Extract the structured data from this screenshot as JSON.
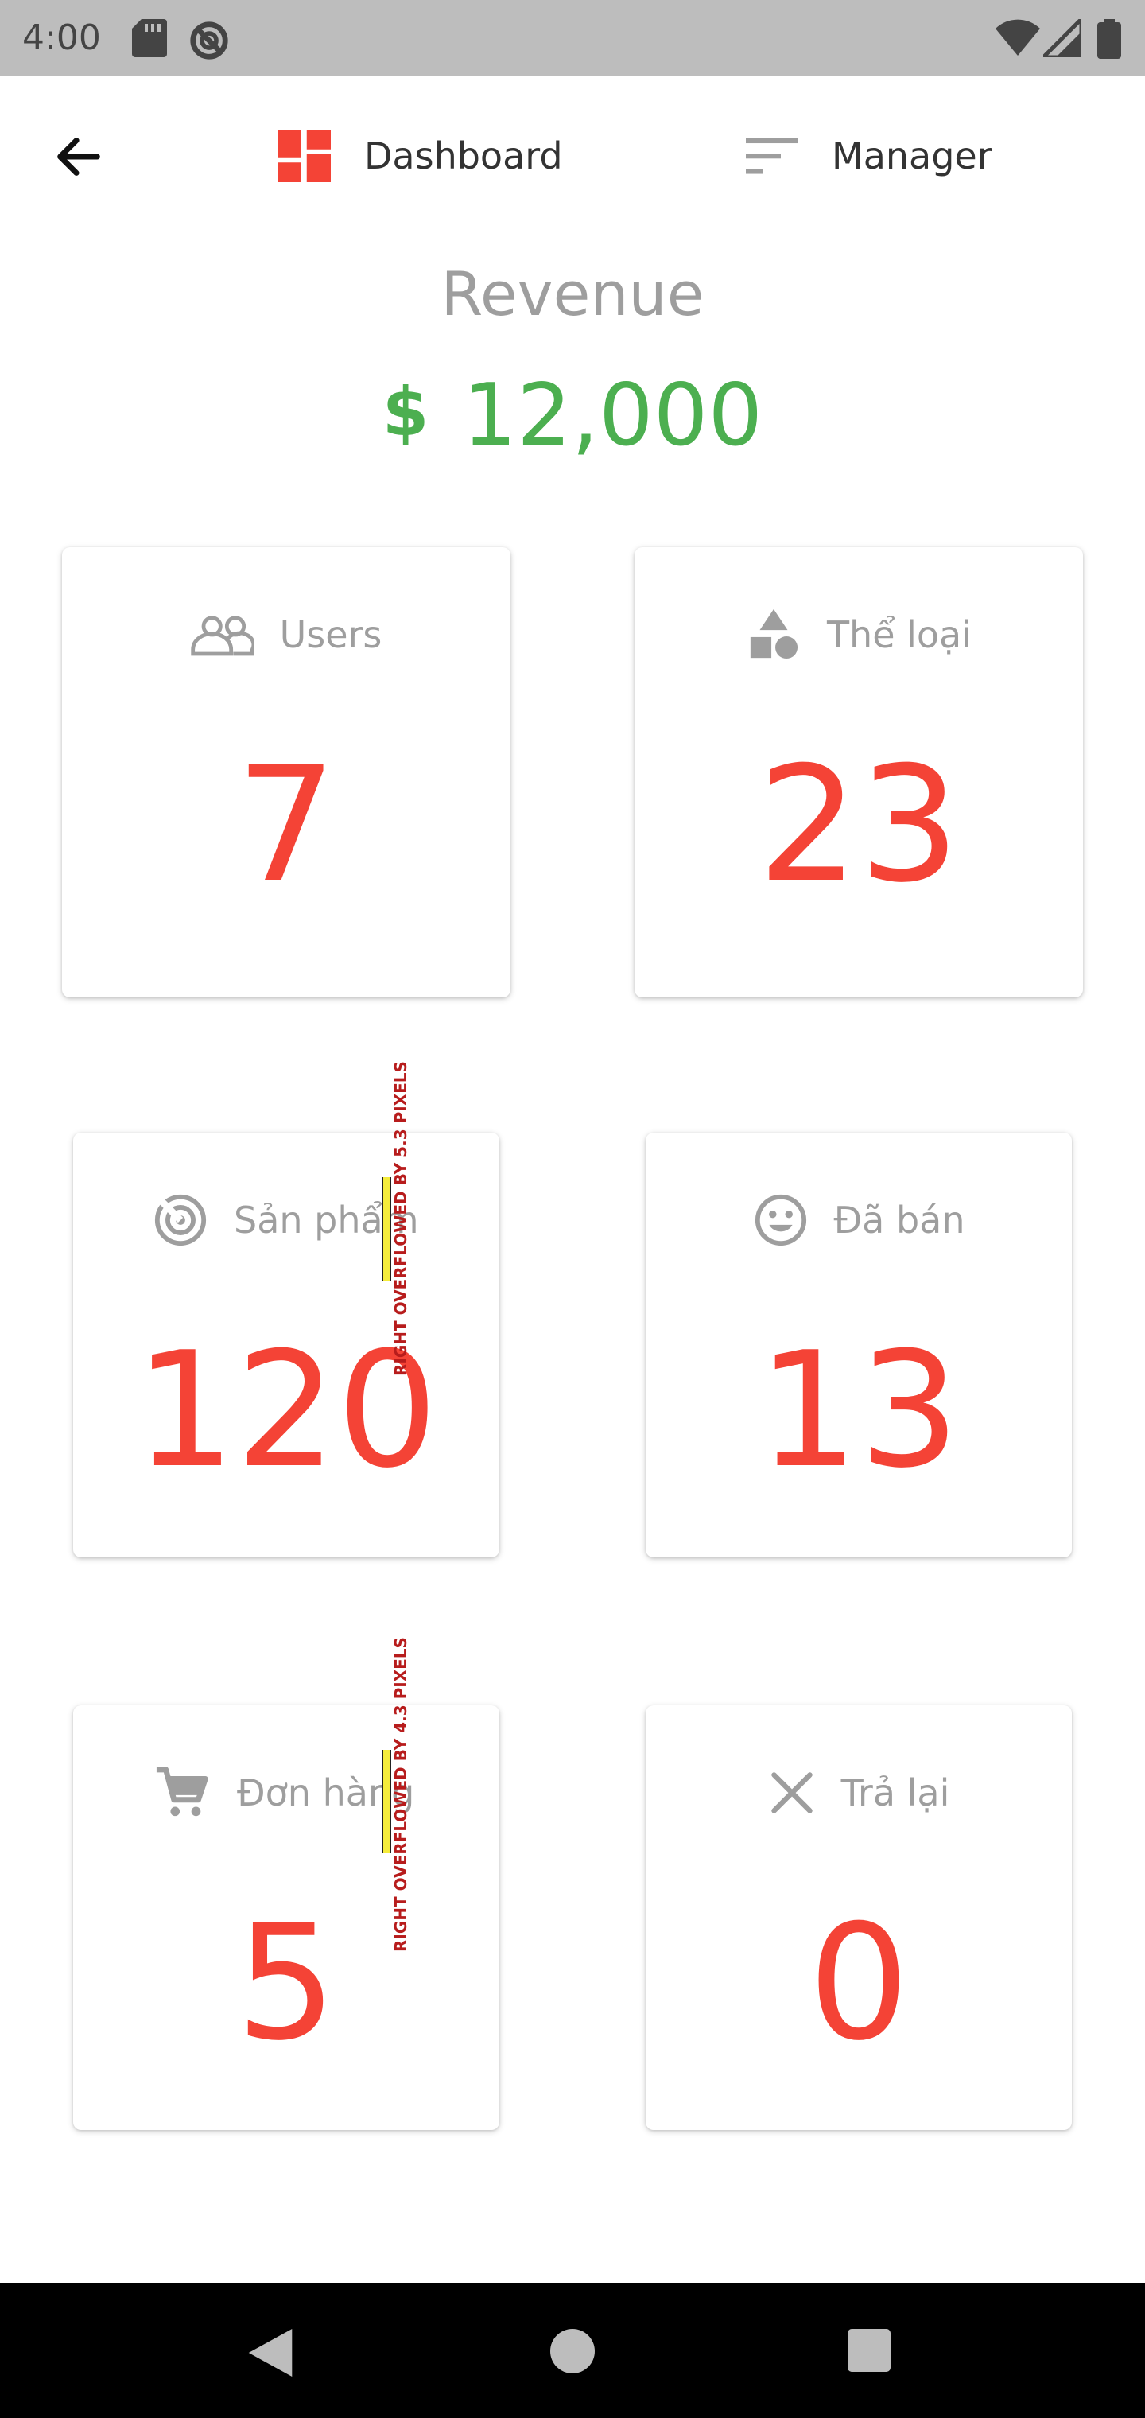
{
  "status_bar": {
    "time": "4:00"
  },
  "app_bar": {
    "dashboard_label": "Dashboard",
    "manager_label": "Manager"
  },
  "revenue": {
    "title": "Revenue",
    "currency": "$",
    "value": "12,000"
  },
  "cards": [
    {
      "label": "Users",
      "value": "7",
      "icon": "people-icon"
    },
    {
      "label": "Thể loại",
      "value": "23",
      "icon": "category-icon"
    },
    {
      "label": "Sản phẩm",
      "value": "120",
      "icon": "radar-icon"
    },
    {
      "label": "Đã bán",
      "value": "13",
      "icon": "smile-icon"
    },
    {
      "label": "Đơn hàng",
      "value": "5",
      "icon": "cart-icon"
    },
    {
      "label": "Trả lại",
      "value": "0",
      "icon": "close-icon"
    }
  ],
  "overflow_warnings": [
    "RIGHT OVERFLOWED BY 5.3 PIXELS",
    "RIGHT OVERFLOWED BY 4.3 PIXELS"
  ],
  "colors": {
    "accent": "#f44336",
    "revenue": "#4caf50",
    "label_gray": "#9e9e9e"
  }
}
